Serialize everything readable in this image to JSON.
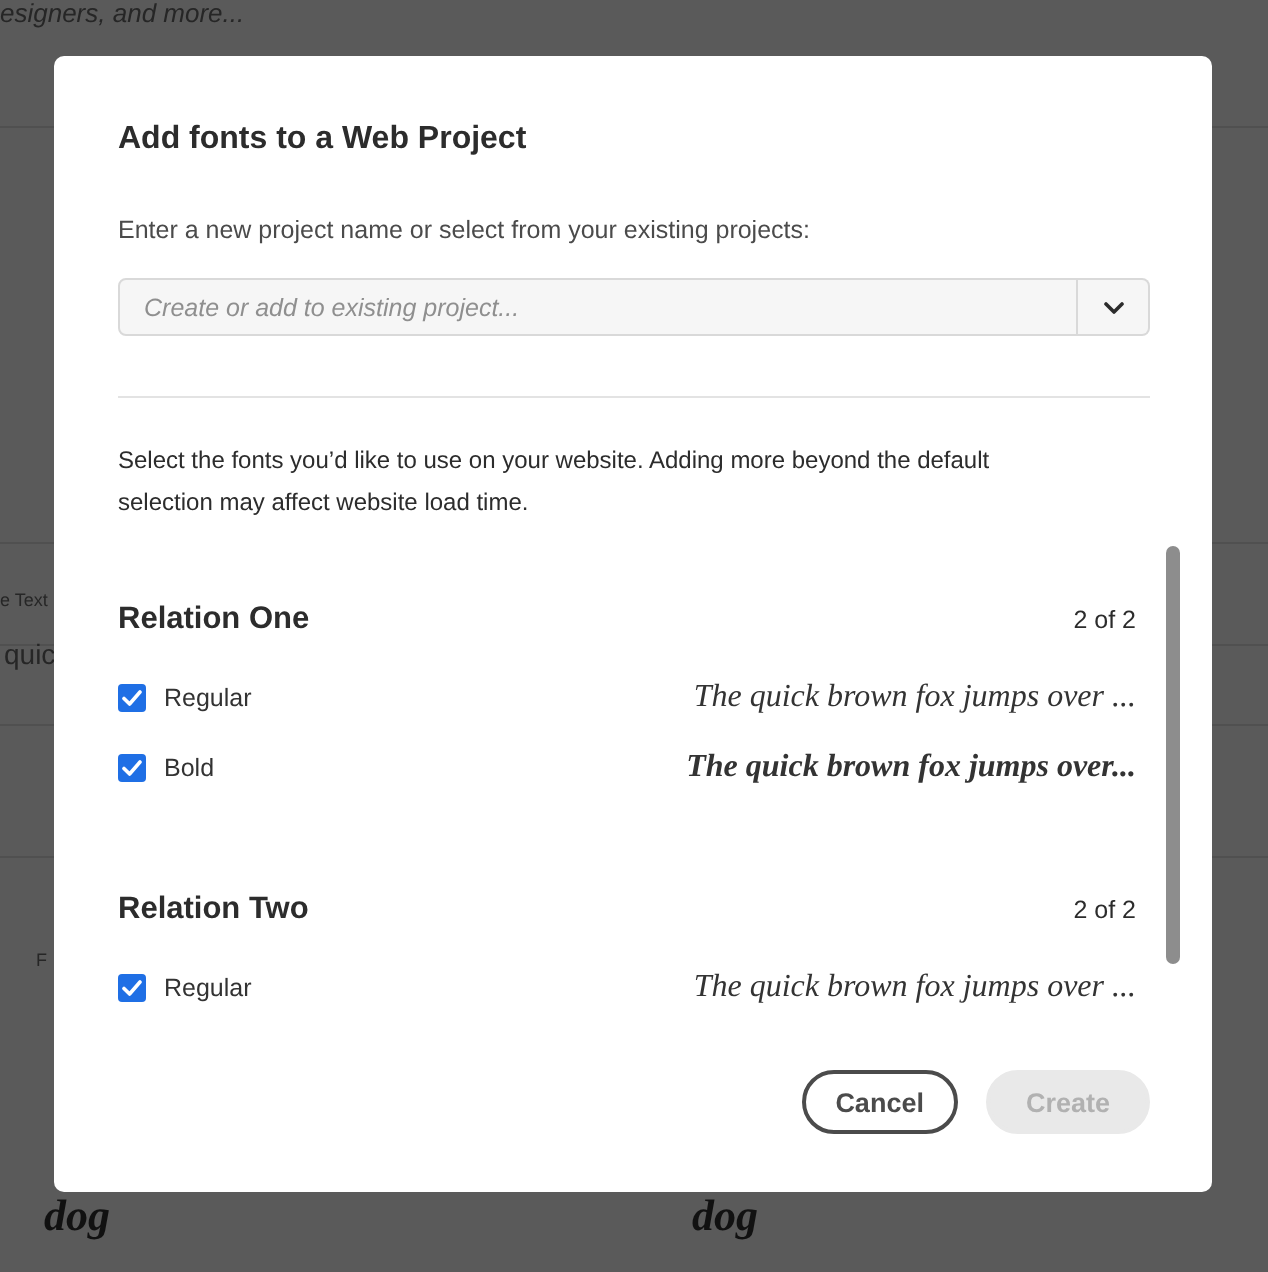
{
  "backdrop": {
    "fragments": [
      {
        "kind": "tagline",
        "text": "esigners, and more..."
      },
      {
        "kind": "label",
        "text": "e Text"
      },
      {
        "kind": "sample",
        "text": "quic"
      },
      {
        "kind": "label",
        "text": "F"
      },
      {
        "kind": "script",
        "text": "dog"
      },
      {
        "kind": "script",
        "text": "dog"
      }
    ]
  },
  "dialog": {
    "title": "Add fonts to a Web Project",
    "project_label": "Enter a new project name or select from your existing projects:",
    "project_field": {
      "placeholder": "Create or add to existing project..."
    },
    "description": "Select the fonts you’d like to use on your website. Adding more beyond the default selection may affect website load time.",
    "sections": [
      {
        "name": "Relation One",
        "count": "2 of 2",
        "fonts": [
          {
            "style": "Regular",
            "kind": "regular",
            "checked": true,
            "sample": "The quick brown fox jumps over ..."
          },
          {
            "style": "Bold",
            "kind": "bold",
            "checked": true,
            "sample": "The quick brown fox jumps over..."
          }
        ]
      },
      {
        "name": "Relation Two",
        "count": "2 of 2",
        "fonts": [
          {
            "style": "Regular",
            "kind": "regular",
            "checked": true,
            "sample": "The quick brown fox jumps over ..."
          }
        ]
      }
    ],
    "buttons": [
      {
        "label": "Cancel",
        "kind": "secondary",
        "disabled": false
      },
      {
        "label": "Create",
        "kind": "primary",
        "disabled": true
      }
    ]
  }
}
